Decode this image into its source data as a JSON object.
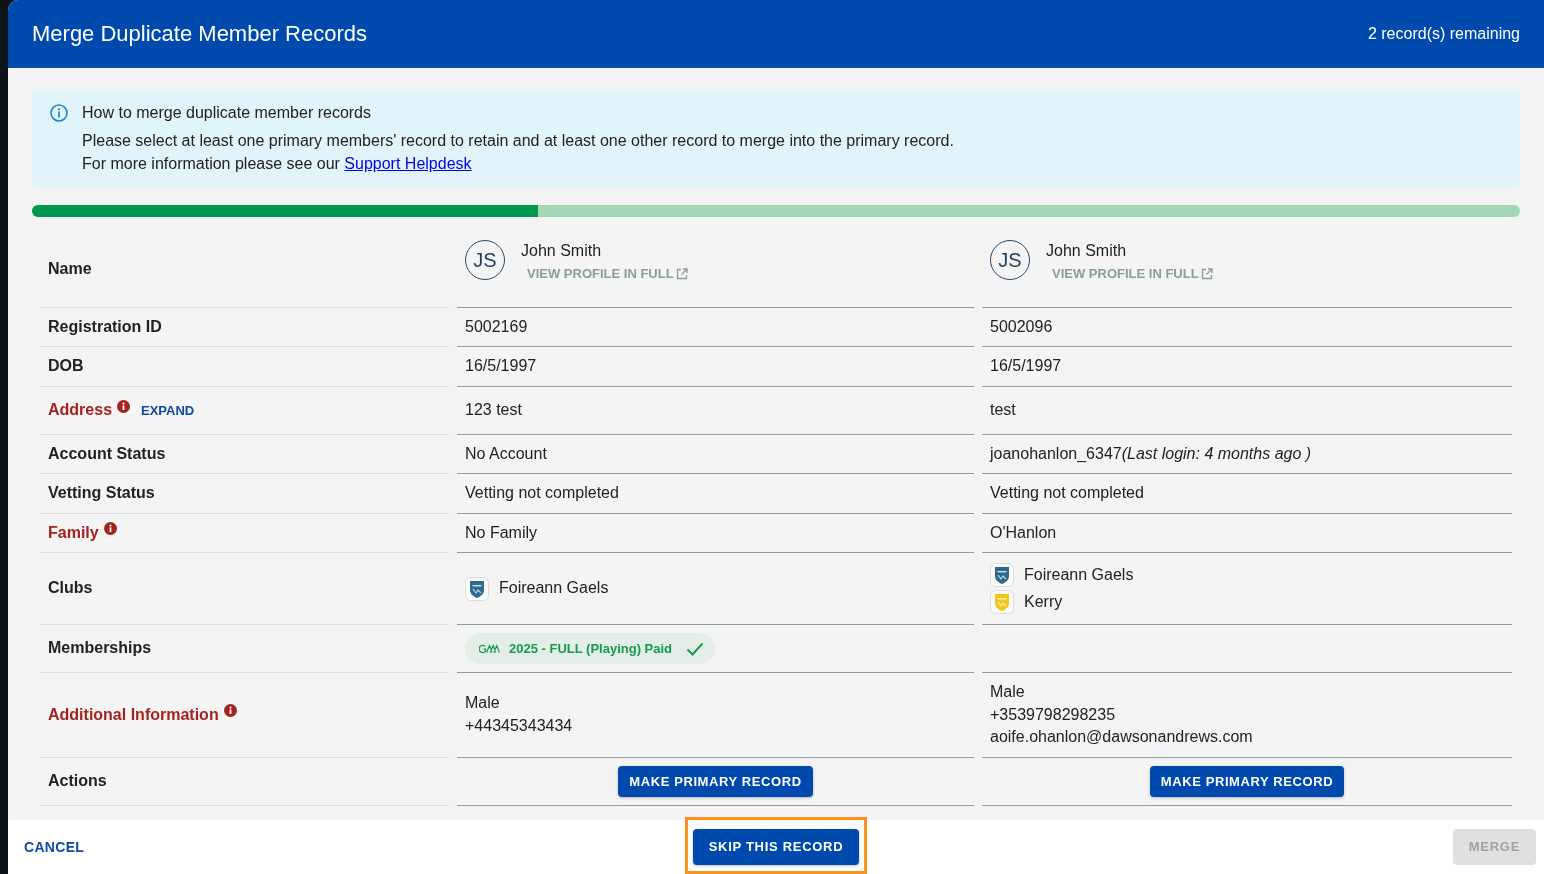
{
  "header": {
    "title": "Merge Duplicate Member Records",
    "remaining": "2 record(s) remaining"
  },
  "info": {
    "title": "How to merge duplicate member records",
    "lines": [
      "Please select at least one primary members' record to retain and at least one other record to merge into the primary record."
    ],
    "more": {
      "text": "For more information please see our",
      "link": "Support Helpdesk"
    }
  },
  "progress": {
    "level": 0.34
  },
  "comparison": {
    "rows": [
      {
        "kind": "name",
        "label": "Name",
        "alert": false,
        "cells": [
          {
            "initials": "JS",
            "name": "John Smith",
            "link": "VIEW PROFILE IN FULL"
          },
          {
            "initials": "JS",
            "name": "John Smith",
            "link": "VIEW PROFILE IN FULL"
          }
        ]
      },
      {
        "kind": "text",
        "label": "Registration ID",
        "alert": false,
        "cells": [
          {
            "lines": [
              "5002169"
            ]
          },
          {
            "lines": [
              "5002096"
            ]
          }
        ]
      },
      {
        "kind": "text",
        "label": "DOB",
        "alert": false,
        "cells": [
          {
            "lines": [
              "16/5/1997"
            ]
          },
          {
            "lines": [
              "16/5/1997"
            ]
          }
        ]
      },
      {
        "kind": "text",
        "label": "Address",
        "alert": true,
        "expand": "EXPAND",
        "cells": [
          {
            "lines": [
              "123 test"
            ]
          },
          {
            "lines": [
              "test"
            ]
          }
        ]
      },
      {
        "kind": "text",
        "label": "Account Status",
        "alert": false,
        "cells": [
          {
            "lines": [
              "No Account"
            ]
          },
          {
            "lines": [
              "joanohanlon_6347"
            ],
            "note": "(Last login: 4 months ago )"
          }
        ]
      },
      {
        "kind": "text",
        "label": "Vetting Status",
        "alert": false,
        "cells": [
          {
            "lines": [
              "Vetting not completed"
            ]
          },
          {
            "lines": [
              "Vetting not completed"
            ]
          }
        ]
      },
      {
        "kind": "text",
        "label": "Family",
        "alert": true,
        "cells": [
          {
            "lines": [
              "No Family"
            ]
          },
          {
            "lines": [
              "O'Hanlon"
            ]
          }
        ]
      },
      {
        "kind": "clubs",
        "label": "Clubs",
        "alert": false,
        "cells": [
          {
            "clubs": [
              {
                "name": "Foireann Gaels",
                "color": "#2c6a8f"
              }
            ]
          },
          {
            "clubs": [
              {
                "name": "Foireann Gaels",
                "color": "#2c6a8f"
              },
              {
                "name": "Kerry",
                "color": "#f3c614"
              }
            ]
          }
        ]
      },
      {
        "kind": "memberships",
        "label": "Memberships",
        "alert": false,
        "cells": [
          {
            "chips": [
              {
                "label": "2025 - FULL (Playing) Paid",
                "verified": true
              }
            ]
          },
          {}
        ]
      },
      {
        "kind": "text",
        "label": "Additional Information",
        "alert": true,
        "cells": [
          {
            "lines": [
              "Male",
              "+44345343434"
            ]
          },
          {
            "lines": [
              "Male",
              "+3539798298235",
              "aoife.ohanlon@dawsonandrews.com"
            ]
          }
        ]
      },
      {
        "kind": "actions",
        "label": "Actions",
        "alert": false,
        "cells": [
          {
            "button": "MAKE PRIMARY RECORD"
          },
          {
            "button": "MAKE PRIMARY RECORD"
          }
        ]
      }
    ]
  },
  "footer": {
    "cancel": "CANCEL",
    "skip": {
      "label": "SKIP THIS RECORD",
      "highlighted": true
    },
    "merge": {
      "label": "MERGE",
      "disabled": true
    }
  }
}
